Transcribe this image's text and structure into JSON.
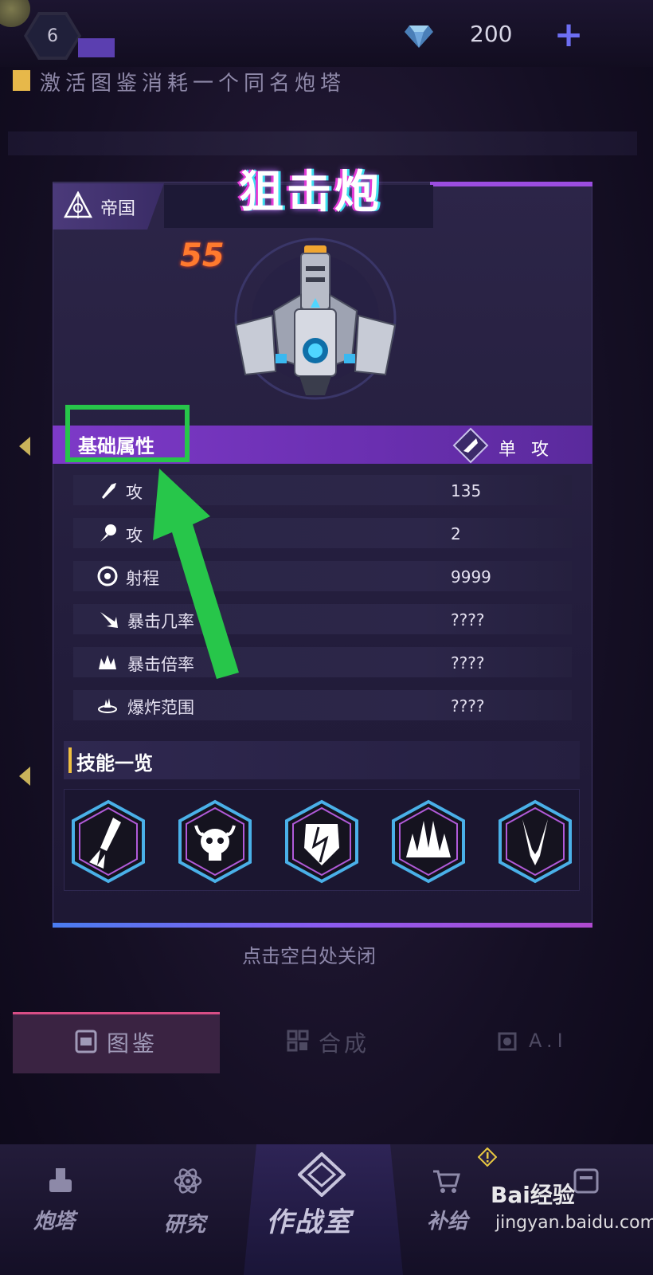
{
  "top_bar": {
    "level": "6",
    "gem_count": "200",
    "plus_label": "+"
  },
  "hint": {
    "text": "激活图鉴消耗一个同名炮塔"
  },
  "tower": {
    "name": "狙击炮",
    "faction": "帝国",
    "level": "55"
  },
  "attributes": {
    "title": "基础属性",
    "attack_type": "单 攻",
    "rows": [
      {
        "label": "攻",
        "value": "135",
        "icon": "bullet-icon"
      },
      {
        "label": "攻",
        "value": "2",
        "icon": "rocket-icon"
      },
      {
        "label": "射程",
        "value": "9999",
        "icon": "target-icon"
      },
      {
        "label": "暴击几率",
        "value": "????",
        "icon": "crit-arrow-icon"
      },
      {
        "label": "暴击倍率",
        "value": "????",
        "icon": "burst-icon"
      },
      {
        "label": "爆炸范围",
        "value": "????",
        "icon": "explosion-icon"
      }
    ]
  },
  "skills": {
    "title": "技能一览",
    "items": [
      "missile-skill-icon",
      "skull-skill-icon",
      "shield-skill-icon",
      "spikes-skill-icon",
      "claw-skill-icon"
    ]
  },
  "close_hint": "点击空白处关闭",
  "tabs": {
    "atlas": "图鉴",
    "synth": "合成",
    "ai": "A.I"
  },
  "bottom_nav": {
    "turret": "炮塔",
    "research": "研究",
    "war_room": "作战室",
    "supply": "补给"
  },
  "watermark": {
    "logo": "Bai经验",
    "url": "jingyan.baidu.com"
  },
  "colors": {
    "accent_purple": "#7d3ac8",
    "highlight_green": "#27c64a",
    "level_orange": "#ff7a2e"
  }
}
